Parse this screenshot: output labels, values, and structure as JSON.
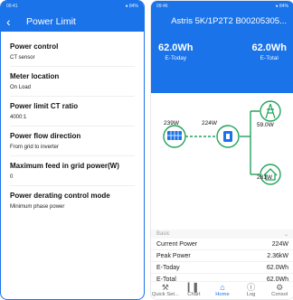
{
  "left": {
    "status": {
      "time": "09:41",
      "icons": "● 84%"
    },
    "appbar": {
      "title": "Power Limit"
    },
    "items": [
      {
        "title": "Power control",
        "value": "CT sensor"
      },
      {
        "title": "Meter location",
        "value": "On Load"
      },
      {
        "title": "Power limit CT ratio",
        "value": "4000:1"
      },
      {
        "title": "Power flow direction",
        "value": "From grid to inverter"
      },
      {
        "title": "Maximum feed in grid power(W)",
        "value": "0"
      },
      {
        "title": "Power derating control mode",
        "value": "Minimum phase power"
      }
    ]
  },
  "right": {
    "status": {
      "time": "09:46",
      "icons": "● 84%"
    },
    "header": {
      "title": "Astris 5K/1P2T2 B00205305...",
      "today_value": "62.0Wh",
      "today_label": "E-Today",
      "total_value": "62.0Wh",
      "total_label": "E-Total"
    },
    "diagram": {
      "pv_power": "239W",
      "inverter_power": "224W",
      "grid_power": "59.0W",
      "load_power": "281W"
    },
    "basic": {
      "section_label": "Basic",
      "rows": [
        {
          "label": "Current Power",
          "value": "224W"
        },
        {
          "label": "Peak Power",
          "value": "2.36kW"
        },
        {
          "label": "E-Today",
          "value": "62.0Wh"
        },
        {
          "label": "E-Total",
          "value": "62.0Wh"
        }
      ]
    },
    "nav": [
      {
        "label": "Quick Set...",
        "icon": "tools-icon"
      },
      {
        "label": "Chart",
        "icon": "chart-icon"
      },
      {
        "label": "Home",
        "icon": "home-icon"
      },
      {
        "label": "Log",
        "icon": "info-icon"
      },
      {
        "label": "Consol",
        "icon": "gear-icon"
      }
    ]
  },
  "colors": {
    "primary": "#1a73e8",
    "accent_green": "#22a35a"
  }
}
